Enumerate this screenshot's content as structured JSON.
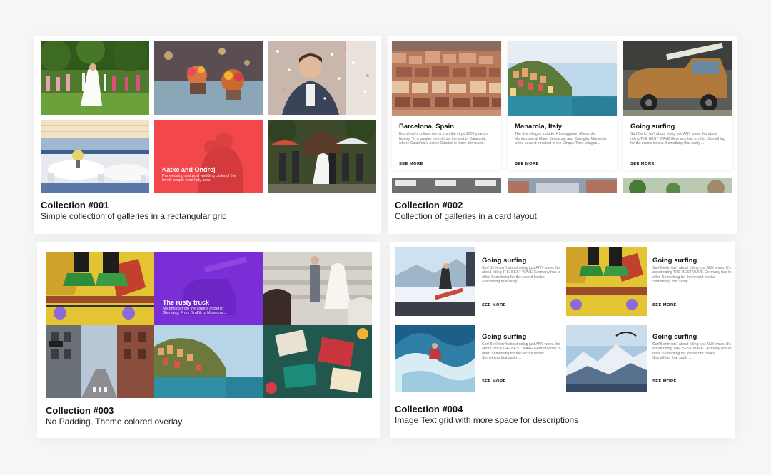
{
  "collections": [
    {
      "title": "Collection #001",
      "subtitle": "Simple collection of galleries in a rectangular grid",
      "overlay": {
        "title": "Katke and Ondrej",
        "text": "Pre wedding and post wedding clicks of the lovely couple from Italy area",
        "color": "#f2484c"
      }
    },
    {
      "title": "Collection #002",
      "subtitle": "Collection of galleries in a card layout",
      "cards": [
        {
          "title": "Barcelona, Spain",
          "text": "Barcelona's culture stems from the city's 2000 years of history. To a greater extent than the rest of Catalonia, where Catalonia's native Catalan is more dominant...",
          "more": "SEE MORE"
        },
        {
          "title": "Manarola, Italy",
          "text": "The five villages include: Riomaggiore, Manarola, Monterosso al Mare, Vernazza, and Corniglia. Manarola is the second smallest of the Cinque Terre villages...",
          "more": "SEE MORE"
        },
        {
          "title": "Going surfing",
          "text": "Surf Berlin isn't about riding just ANY wave. It's about riding THE BEST WAVE Germany has to offer. Something for the record books. Something that sadly ...",
          "more": "SEE MORE"
        }
      ]
    },
    {
      "title": "Collection #003",
      "subtitle": "No Padding. Theme colored overlay",
      "overlay": {
        "title": "The rusty truck",
        "text": "My photos from the streets of Berlin, Germany. From Graffiti to Museums...",
        "color": "#7a2fd6"
      }
    },
    {
      "title": "Collection #004",
      "subtitle": "Image Text grid with more space for descriptions",
      "items": [
        {
          "title": "Going surfing",
          "text": "Surf Berlin isn't about riding just ANY wave. It's about riding THE BEST WAVE Germany has to offer. Something for the record books. Something that sadly ...",
          "more": "SEE MORE"
        },
        {
          "title": "Going surfing",
          "text": "Surf Berlin isn't about riding just ANY wave. It's about riding THE BEST WAVE Germany has to offer. Something for the record books. Something that sadly ...",
          "more": "SEE MORE"
        },
        {
          "title": "Going surfing",
          "text": "Surf Berlin isn't about riding just ANY wave. It's about riding THE BEST WAVE Germany has to offer. Something for the record books. Something that sadly ...",
          "more": "SEE MORE"
        },
        {
          "title": "Going surfing",
          "text": "Surf Berlin isn't about riding just ANY wave. It's about riding THE BEST WAVE Germany has to offer. Something for the record books. Something that sadly ...",
          "more": "SEE MORE"
        }
      ]
    }
  ]
}
